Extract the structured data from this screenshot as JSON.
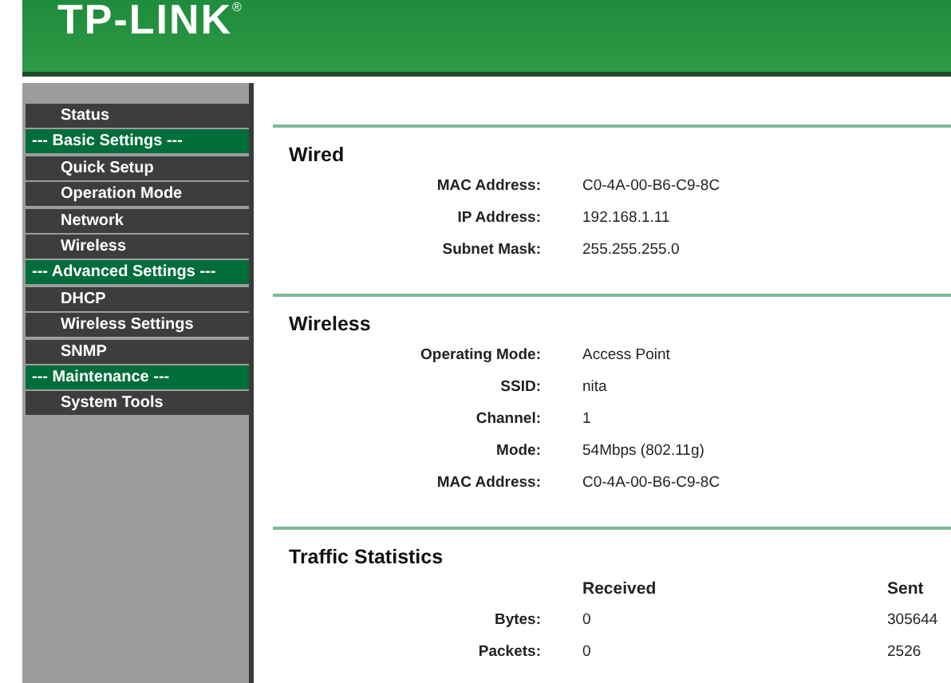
{
  "header": {
    "logo": "TP-LINK",
    "logo_mark": "®"
  },
  "sidebar": {
    "items": [
      {
        "label": "Status",
        "kind": "link"
      },
      {
        "label": "--- Basic Settings ---",
        "kind": "group"
      },
      {
        "label": "Quick Setup",
        "kind": "link"
      },
      {
        "label": "Operation Mode",
        "kind": "link"
      },
      {
        "label": "Network",
        "kind": "link"
      },
      {
        "label": "Wireless",
        "kind": "link"
      },
      {
        "label": "--- Advanced Settings ---",
        "kind": "group"
      },
      {
        "label": "DHCP",
        "kind": "link"
      },
      {
        "label": "Wireless Settings",
        "kind": "link"
      },
      {
        "label": "SNMP",
        "kind": "link"
      },
      {
        "label": "--- Maintenance ---",
        "kind": "group"
      },
      {
        "label": "System Tools",
        "kind": "link"
      }
    ]
  },
  "sections": [
    {
      "title": "Wired",
      "kind": "fields",
      "rows": [
        {
          "label": "MAC Address:",
          "value": "C0-4A-00-B6-C9-8C"
        },
        {
          "label": "IP Address:",
          "value": "192.168.1.11"
        },
        {
          "label": "Subnet Mask:",
          "value": "255.255.255.0"
        }
      ]
    },
    {
      "title": "Wireless",
      "kind": "fields",
      "rows": [
        {
          "label": "Operating Mode:",
          "value": "Access Point"
        },
        {
          "label": "SSID:",
          "value": "nita"
        },
        {
          "label": "Channel:",
          "value": "1"
        },
        {
          "label": "Mode:",
          "value": "54Mbps (802.11g)"
        },
        {
          "label": "MAC Address:",
          "value": "C0-4A-00-B6-C9-8C"
        }
      ]
    },
    {
      "title": "Traffic Statistics",
      "kind": "table",
      "columns": [
        "Received",
        "Sent"
      ],
      "rows": [
        {
          "label": "Bytes:",
          "values": [
            "0",
            "305644"
          ]
        },
        {
          "label": "Packets:",
          "values": [
            "0",
            "2526"
          ]
        }
      ]
    }
  ]
}
